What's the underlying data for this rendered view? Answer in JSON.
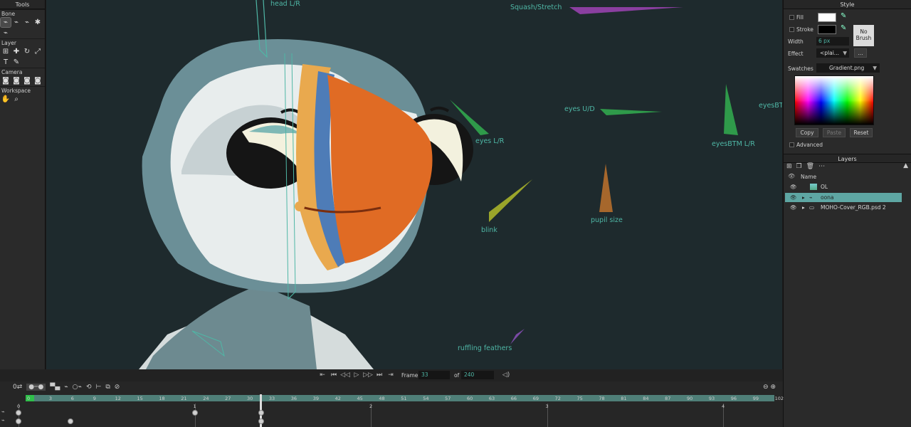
{
  "tools_panel": {
    "title": "Tools",
    "sections": [
      {
        "name": "Bone"
      },
      {
        "name": "Layer"
      },
      {
        "name": "Camera"
      },
      {
        "name": "Workspace"
      }
    ]
  },
  "canvas": {
    "labels": {
      "head": "head L/R",
      "squash": "Squash/Stretch",
      "eyes_lr": "eyes L/R",
      "eyes_ud": "eyes U/D",
      "eyes_btm_lr": "eyesBTM L/R",
      "eyes_btm_cut": "eyesBT",
      "blink": "blink",
      "pupil": "pupil size",
      "ruffling": "ruffling feathers"
    },
    "colors": {
      "background": "#1e2a2d",
      "accent": "#4fb7a6"
    }
  },
  "transport": {
    "frame_label": "Frame",
    "frame_value": "33",
    "of_label": "of",
    "total_value": "240"
  },
  "style_panel": {
    "title": "Style",
    "fill_label": "Fill",
    "stroke_label": "Stroke",
    "no_brush": [
      "No",
      "Brush"
    ],
    "width_label": "Width",
    "width_value": "6 px",
    "effect_label": "Effect",
    "effect_value": "<plai...",
    "effect_more": "...",
    "swatches_label": "Swatches",
    "swatches_value": "Gradient.png",
    "copy": "Copy",
    "paste": "Paste",
    "reset": "Reset",
    "advanced": "Advanced"
  },
  "layers_panel": {
    "title": "Layers",
    "name_header": "Name",
    "rows": [
      {
        "name": "OL"
      },
      {
        "name": "oona"
      },
      {
        "name": "MOHO-Cover_RGB.psd 2"
      }
    ]
  },
  "timeline": {
    "frame_ticks": [
      "0",
      "3",
      "6",
      "9",
      "12",
      "15",
      "18",
      "21",
      "24",
      "27",
      "30",
      "33",
      "36",
      "39",
      "42",
      "45",
      "48",
      "51",
      "54",
      "57",
      "60",
      "63",
      "66",
      "69",
      "72",
      "75",
      "78",
      "81",
      "84",
      "87",
      "90",
      "93",
      "96",
      "99",
      "102"
    ],
    "second_marks": [
      "0",
      "1",
      "2",
      "3",
      "4"
    ]
  }
}
